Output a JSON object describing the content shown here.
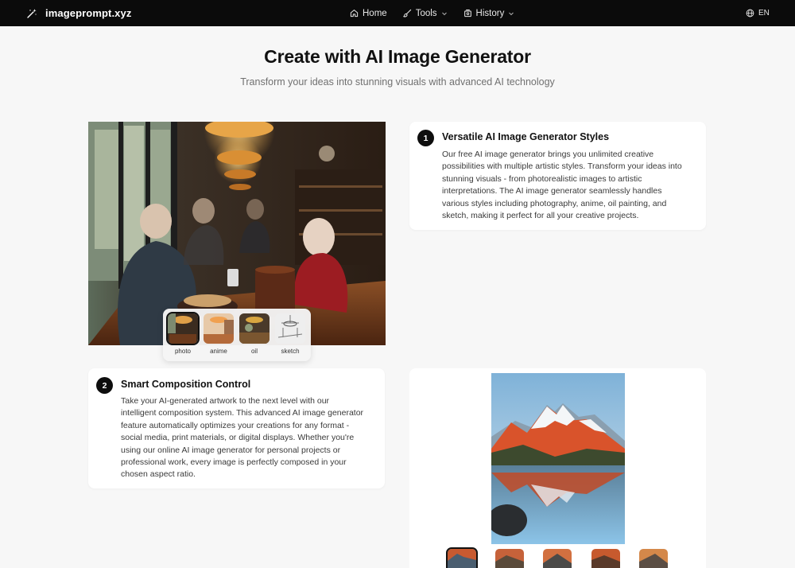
{
  "nav": {
    "brand": "imageprompt.xyz",
    "items": [
      {
        "label": "Home",
        "icon": "home-icon"
      },
      {
        "label": "Tools",
        "icon": "brush-icon",
        "dropdown": true
      },
      {
        "label": "History",
        "icon": "history-icon",
        "dropdown": true
      }
    ],
    "language": "EN"
  },
  "hero": {
    "title": "Create with AI Image Generator",
    "subtitle": "Transform your ideas into stunning visuals with advanced AI technology"
  },
  "style_thumbs": [
    {
      "label": "photo",
      "selected": true
    },
    {
      "label": "anime",
      "selected": false
    },
    {
      "label": "oil",
      "selected": false
    },
    {
      "label": "sketch",
      "selected": false
    }
  ],
  "features": [
    {
      "number": "1",
      "title": "Versatile AI Image Generator Styles",
      "lines": [
        "Our free AI image generator brings you unlimited creative",
        "possibilities with multiple artistic styles. Transform your ideas into",
        "stunning visuals - from photorealistic images to artistic",
        "interpretations. The AI image generator seamlessly handles",
        "various styles including photography, anime, oil painting, and",
        "sketch, making it perfect for all your creative projects."
      ]
    },
    {
      "number": "2",
      "title": "Smart Composition Control",
      "lines": [
        "Take your AI-generated artwork to the next level with our",
        "intelligent composition system. This advanced AI image generator",
        "feature automatically optimizes your creations for any format -",
        "social media, print materials, or digital displays. Whether you're",
        "using our online AI image generator for personal projects or",
        "professional work, every image is perfectly composed in your",
        "chosen aspect ratio."
      ]
    }
  ],
  "colors": {
    "nav_bg": "#0b0b0b",
    "page_bg": "#f7f7f7",
    "accent": "#0e0e0e"
  }
}
